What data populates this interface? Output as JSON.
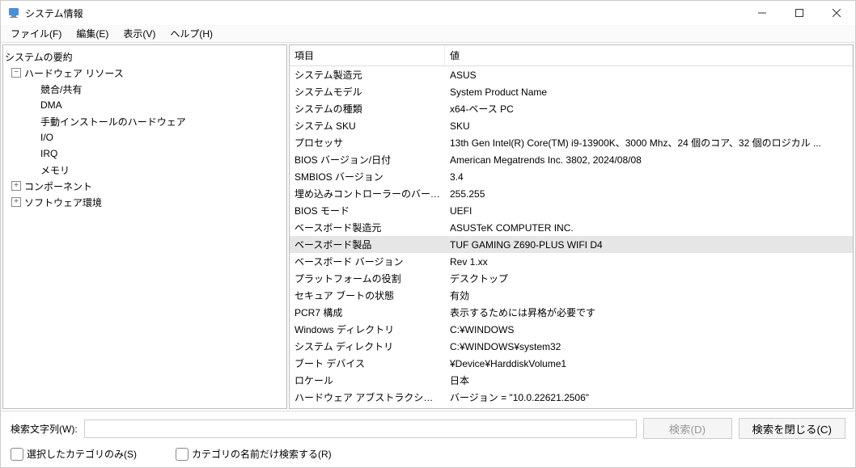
{
  "window": {
    "title": "システム情報"
  },
  "menu": {
    "file": "ファイル(F)",
    "edit": "編集(E)",
    "view": "表示(V)",
    "help": "ヘルプ(H)"
  },
  "tree": {
    "root": "システムの要約",
    "hardware": "ハードウェア リソース",
    "hw_children": [
      "競合/共有",
      "DMA",
      "手動インストールのハードウェア",
      "I/O",
      "IRQ",
      "メモリ"
    ],
    "components": "コンポーネント",
    "software": "ソフトウェア環境"
  },
  "list": {
    "header_item": "項目",
    "header_value": "値",
    "rows": [
      {
        "item": "システム製造元",
        "value": "ASUS"
      },
      {
        "item": "システムモデル",
        "value": "System Product Name"
      },
      {
        "item": "システムの種類",
        "value": "x64-ベース PC"
      },
      {
        "item": "システム SKU",
        "value": "SKU"
      },
      {
        "item": "プロセッサ",
        "value": "13th Gen Intel(R) Core(TM) i9-13900K、3000 Mhz、24 個のコア、32 個のロジカル ..."
      },
      {
        "item": "BIOS バージョン/日付",
        "value": "American Megatrends Inc. 3802, 2024/08/08"
      },
      {
        "item": "SMBIOS バージョン",
        "value": "3.4"
      },
      {
        "item": "埋め込みコントローラーのバージョン",
        "value": "255.255"
      },
      {
        "item": "BIOS モード",
        "value": "UEFI"
      },
      {
        "item": "ベースボード製造元",
        "value": "ASUSTeK COMPUTER INC."
      },
      {
        "item": "ベースボード製品",
        "value": "TUF GAMING Z690-PLUS WIFI D4"
      },
      {
        "item": "ベースボード バージョン",
        "value": "Rev 1.xx"
      },
      {
        "item": "プラットフォームの役割",
        "value": "デスクトップ"
      },
      {
        "item": "セキュア ブートの状態",
        "value": "有効"
      },
      {
        "item": "PCR7 構成",
        "value": "表示するためには昇格が必要です"
      },
      {
        "item": "Windows ディレクトリ",
        "value": "C:¥WINDOWS"
      },
      {
        "item": "システム ディレクトリ",
        "value": "C:¥WINDOWS¥system32"
      },
      {
        "item": "ブート デバイス",
        "value": "¥Device¥HarddiskVolume1"
      },
      {
        "item": "ロケール",
        "value": "日本"
      },
      {
        "item": "ハードウェア アブストラクション レイヤー",
        "value": "バージョン = \"10.0.22621.2506\""
      }
    ],
    "selected_index": 10
  },
  "footer": {
    "search_label": "検索文字列(W):",
    "find": "検索(D)",
    "close_find": "検索を閉じる(C)",
    "selected_only": "選択したカテゴリのみ(S)",
    "category_names_only": "カテゴリの名前だけ検索する(R)"
  }
}
